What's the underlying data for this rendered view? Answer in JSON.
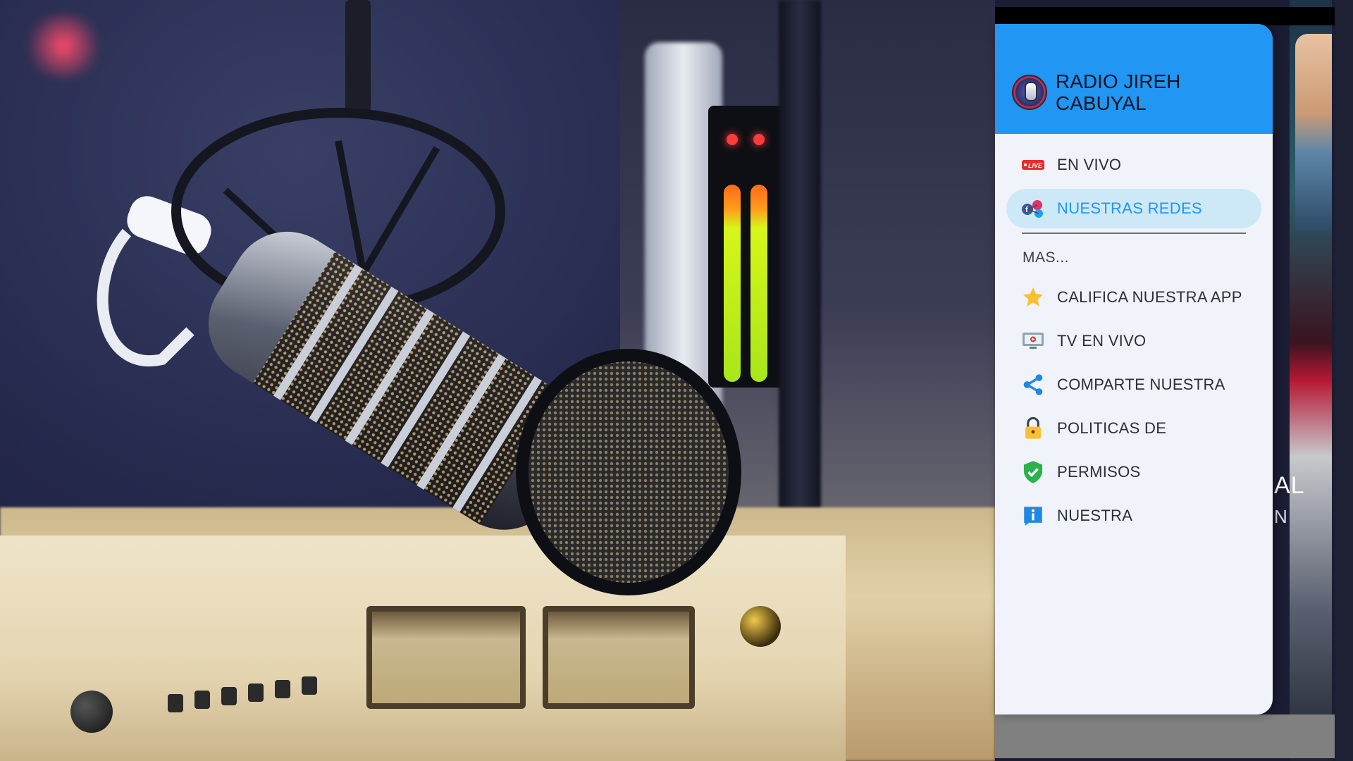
{
  "drawer": {
    "app_title": "RADIO JIREH CABUYAL",
    "header_color": "#2196f3",
    "primary_items": [
      {
        "label": "EN VIVO",
        "icon": "live-badge-icon",
        "active": false
      },
      {
        "label": "NUESTRAS REDES",
        "icon": "social-networks-icon",
        "active": true
      }
    ],
    "section_title": "MAS...",
    "secondary_items": [
      {
        "label": "CALIFICA NUESTRA APP",
        "icon": "star-icon"
      },
      {
        "label": "TV EN VIVO",
        "icon": "tv-icon"
      },
      {
        "label": "COMPARTE NUESTRA",
        "icon": "share-icon"
      },
      {
        "label": "POLITICAS DE",
        "icon": "lock-icon"
      },
      {
        "label": "PERMISOS",
        "icon": "shield-check-icon"
      },
      {
        "label": "NUESTRA",
        "icon": "info-icon"
      }
    ]
  },
  "background": {
    "peek_text_1": "AL",
    "peek_text_2": "N"
  },
  "colors": {
    "accent": "#2196f3",
    "active_item_bg": "#cde9f7",
    "drawer_bg": "#f1f3fb"
  },
  "live_badge_text": "LIVE"
}
